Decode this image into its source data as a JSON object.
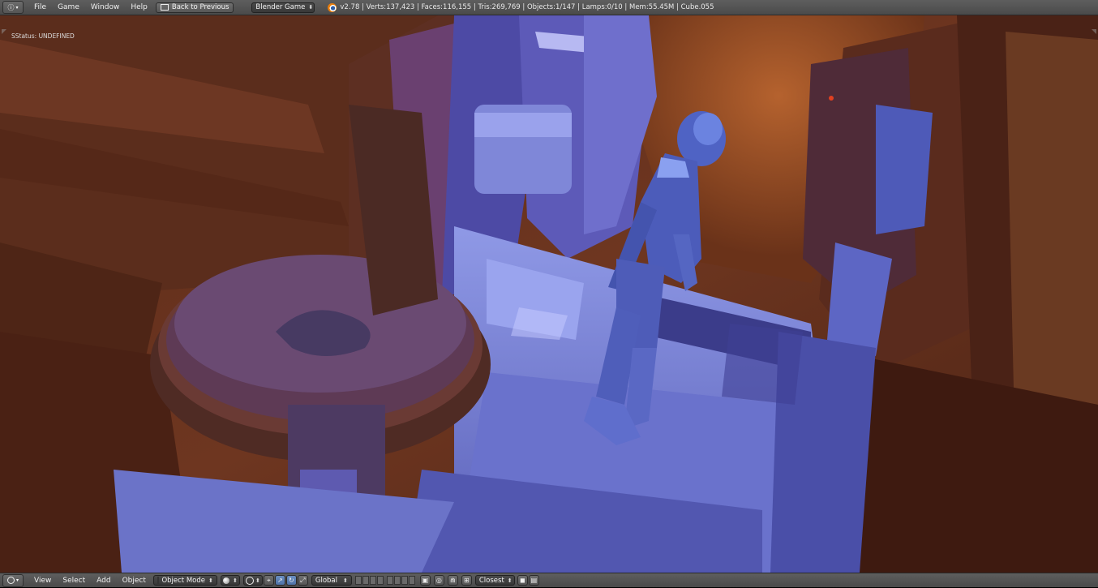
{
  "top": {
    "menus": [
      "File",
      "Game",
      "Window",
      "Help"
    ],
    "back_button": "Back to Previous",
    "engine": "Blender Game",
    "stats": "v2.78 | Verts:137,423 | Faces:116,155 | Tris:269,769 | Objects:1/147 | Lamps:0/10 | Mem:55.45M | Cube.055"
  },
  "viewport": {
    "status_text": "SStatus: UNDEFINED"
  },
  "bottom": {
    "menus": [
      "View",
      "Select",
      "Add",
      "Object"
    ],
    "mode": "Object Mode",
    "orientation": "Global",
    "snap_target": "Closest"
  },
  "colors": {
    "header_bg": "#535353",
    "scene_orange": "#7a3a1c",
    "scene_blue": "#6a78d8",
    "accent_blue": "#5680c2"
  }
}
